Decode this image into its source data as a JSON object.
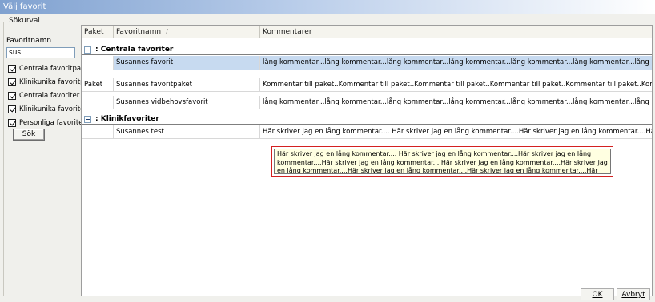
{
  "window": {
    "title": "Välj favorit"
  },
  "search_panel": {
    "group_title": "Sökurval",
    "field_label": "Favoritnamn",
    "search_value": "sus",
    "checkboxes": [
      {
        "label": "Centrala favoritpaket",
        "checked": true
      },
      {
        "label": "Klinikunika favoritpaket",
        "checked": true
      },
      {
        "label": "Centrala favoriter",
        "checked": true
      },
      {
        "label": "Klinikunika favoriter",
        "checked": true
      },
      {
        "label": "Personliga favoriter",
        "checked": true
      }
    ],
    "search_button": "Sök"
  },
  "grid": {
    "columns": [
      "Paket",
      "Favoritnamn",
      "Kommentarer"
    ],
    "sort_indicator": "/",
    "groups": [
      {
        "label": ": Centrala favoriter",
        "rows": [
          {
            "paket": "",
            "name": "Susannes favorit",
            "comment": "lång kommentar...lång kommentar...lång kommentar...lång kommentar...lång kommentar...lång kommentar...lång kommentar...lång kommentar...lån...",
            "selected": true
          },
          {
            "paket": "Paket",
            "name": "Susannes favoritpaket",
            "comment": "Kommentar till paket..Kommentar till paket..Kommentar till paket..Kommentar till paket..Kommentar till paket..Kommentar till paket..Kommentar till p...",
            "selected": false
          },
          {
            "paket": "",
            "name": "Susannes vidbehovsfavorit",
            "comment": "lång kommentar...lång kommentar...lång kommentar...lång kommentar...lång kommentar...lång kommentar...lång kommentar...lång kommentar...lån...",
            "selected": false
          }
        ]
      },
      {
        "label": ": Klinikfavoriter",
        "rows": [
          {
            "paket": "",
            "name": "Susannes test",
            "comment": "Här skriver jag en lång kommentar.... Här skriver jag en lång kommentar....Här skriver jag en lång kommentar....Här skriver jag en lång kommentar....Hä...",
            "selected": false
          }
        ]
      }
    ]
  },
  "tooltip": {
    "text": "Här skriver jag en lång kommentar.... Här skriver jag en lång kommentar....Här skriver jag en lång kommentar....Här skriver jag en lång kommentar....Här skriver jag en lång kommentar....Här skriver jag en lång kommentar....Här skriver jag en lång kommentar....Här skriver jag en lång kommentar....Här skriver jag en lång kommentar.",
    "highlight_color": "#d42020"
  },
  "footer": {
    "ok_label": "OK",
    "cancel_label": "Avbryt"
  },
  "icons": {
    "checkbox": "check-icon",
    "group_toggle": "collapse-icon",
    "sort": "sort-icon"
  }
}
